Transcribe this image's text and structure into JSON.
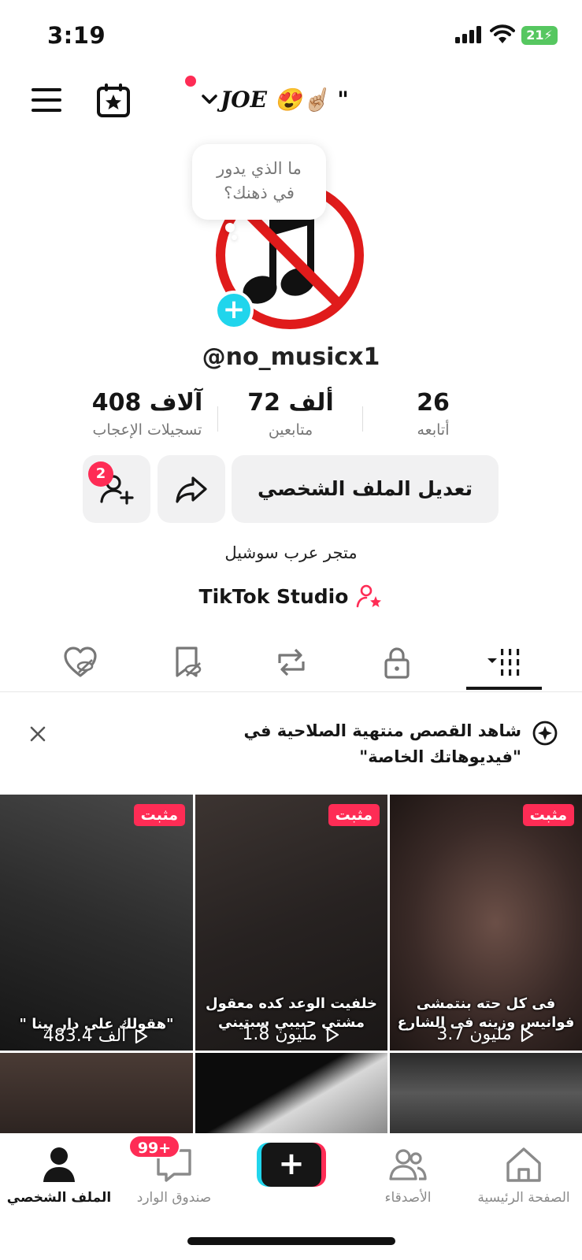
{
  "status_bar": {
    "time": "3:19",
    "battery": "21"
  },
  "header": {
    "title": "JOE 😍☝🏼 \""
  },
  "avatar": {
    "bubble_line1": "ما الذي يدور",
    "bubble_line2": "في ذهنك؟"
  },
  "profile": {
    "username": "@no_musicx1"
  },
  "stats": [
    {
      "value": "26",
      "label": "أتابعه"
    },
    {
      "value": "72 ألف",
      "label": "متابعين"
    },
    {
      "value": "408 آلاف",
      "label": "تسجيلات الإعجاب"
    }
  ],
  "actions": {
    "edit_label": "تعديل الملف الشخصي",
    "friends_badge": "2"
  },
  "bio": "متجر عرب سوشيل",
  "studio_label": "TikTok Studio",
  "tabs": [
    "videos-tab",
    "private-tab",
    "reposts-tab",
    "favorites-tab",
    "liked-tab"
  ],
  "banner": {
    "text": "شاهد القصص منتهية الصلاحية في \"فيديوهاتك الخاصة\""
  },
  "videos": [
    {
      "pinned": "مثبت",
      "caption": "فى كل حته بنتمشى فوانيس وزينه فى الشارع",
      "views": "3.7 مليون"
    },
    {
      "pinned": "مثبت",
      "caption": "خلفيت الوعد كده معقول مشتي حبيبي سبتيني",
      "views": "1.8 مليون"
    },
    {
      "pinned": "مثبت",
      "caption": "\"هقولك على دار بينا \"",
      "views": "483.4 ألف"
    }
  ],
  "nav": {
    "home": "الصفحة الرئيسية",
    "friends": "الأصدقاء",
    "inbox": "صندوق الوارد",
    "inbox_badge": "99+",
    "profile": "الملف الشخصي"
  },
  "colors": {
    "accent": "#fe2c55",
    "cyan": "#20d5ec",
    "button_bg": "#f1f1f2"
  }
}
